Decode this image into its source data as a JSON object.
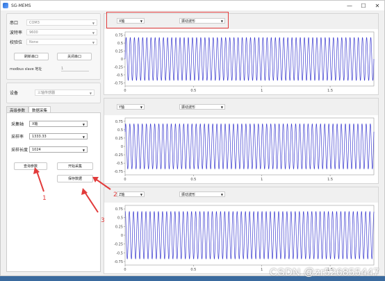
{
  "window": {
    "title": "SG-MEMS",
    "min": "—",
    "max": "☐",
    "close": "✕"
  },
  "serial": {
    "port_label": "串口",
    "port_value": "COM3",
    "baud_label": "波特率",
    "baud_value": "9600",
    "parity_label": "校验位",
    "parity_value": "None",
    "open_btn": "刷新串口",
    "close_btn": "关闭串口",
    "modbus_label": "modbus slave 地址",
    "modbus_value": "1"
  },
  "device": {
    "label": "设备",
    "value": "三轴传感器"
  },
  "tabs": [
    {
      "label": "高级参数"
    },
    {
      "label": "数据采集"
    }
  ],
  "acquire": {
    "axis_label": "采集轴",
    "axis_value": "X轴",
    "rate_label": "采样率",
    "rate_value": "1333.33",
    "len_label": "采样长度",
    "len_value": "1024",
    "query_btn": "查询参数",
    "start_btn": "开始采集",
    "save_btn": "保存数据"
  },
  "plots": [
    {
      "axis": "X轴",
      "mode": "振动波形"
    },
    {
      "axis": "Y轴",
      "mode": "振动波形"
    },
    {
      "axis": "Z轴",
      "mode": "振动波形"
    }
  ],
  "plot_axes": {
    "yticks": [
      "0.75",
      "0.5",
      "0.25",
      "0",
      "-0.25",
      "-0.5",
      "-0.75"
    ],
    "xticks": [
      "0",
      "0.5",
      "1",
      "1.5"
    ],
    "line_color": "#3b3bd0"
  },
  "annotations": {
    "n1": "1",
    "n2": "2",
    "n3": "3",
    "color": "#e23b3b"
  },
  "watermark": "CSDN @zr526855447"
}
